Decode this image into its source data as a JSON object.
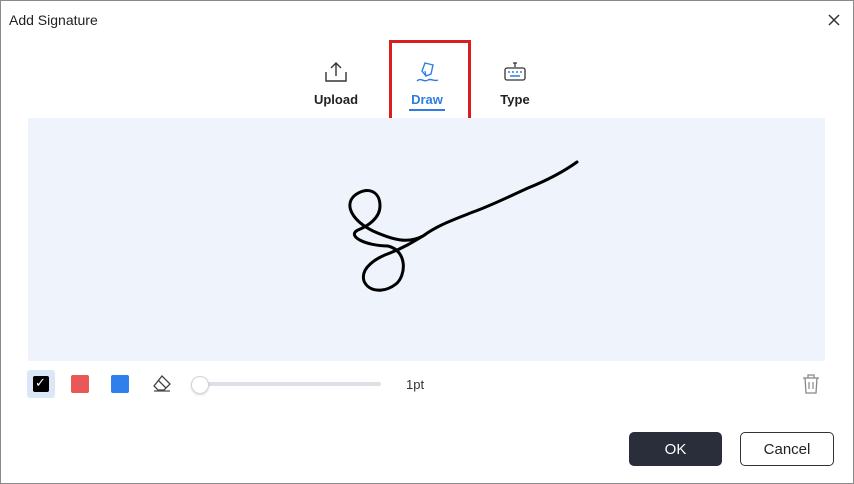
{
  "dialog": {
    "title": "Add Signature"
  },
  "tabs": [
    {
      "label": "Upload",
      "icon": "upload-icon",
      "active": false
    },
    {
      "label": "Draw",
      "icon": "pen-icon",
      "active": true
    },
    {
      "label": "Type",
      "icon": "keyboard-icon",
      "active": false
    }
  ],
  "toolbar": {
    "colors": [
      {
        "name": "black",
        "hex": "#000000",
        "selected": true
      },
      {
        "name": "red",
        "hex": "#eb5757",
        "selected": false
      },
      {
        "name": "blue",
        "hex": "#2f80ed",
        "selected": false
      }
    ],
    "stroke_width_label": "1pt",
    "stroke_width_fraction": 0.0
  },
  "buttons": {
    "ok": "OK",
    "cancel": "Cancel"
  },
  "theme": {
    "accent": "#2f7de1",
    "canvas_bg": "#eef3fc",
    "highlight": "#d81e1e",
    "primary_button": "#2a2d3a"
  }
}
